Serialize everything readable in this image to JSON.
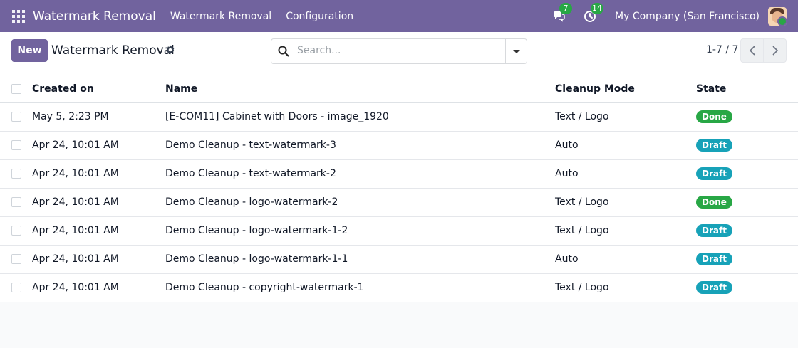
{
  "navbar": {
    "brand": "Watermark Removal",
    "menu": [
      "Watermark Removal",
      "Configuration"
    ],
    "messages_count": "7",
    "activities_count": "14",
    "company": "My Company (San Francisco)"
  },
  "control_panel": {
    "new_label": "New",
    "title": "Watermark Removal",
    "search_placeholder": "Search...",
    "pager": "1-7 / 7"
  },
  "table": {
    "headers": [
      "Created on",
      "Name",
      "Cleanup Mode",
      "State"
    ],
    "rows": [
      {
        "created": "May 5, 2:23 PM",
        "name": "[E-COM11] Cabinet with Doors - image_1920",
        "mode": "Text / Logo",
        "state": "Done"
      },
      {
        "created": "Apr 24, 10:01 AM",
        "name": "Demo Cleanup - text-watermark-3",
        "mode": "Auto",
        "state": "Draft"
      },
      {
        "created": "Apr 24, 10:01 AM",
        "name": "Demo Cleanup - text-watermark-2",
        "mode": "Auto",
        "state": "Draft"
      },
      {
        "created": "Apr 24, 10:01 AM",
        "name": "Demo Cleanup - logo-watermark-2",
        "mode": "Text / Logo",
        "state": "Done"
      },
      {
        "created": "Apr 24, 10:01 AM",
        "name": "Demo Cleanup - logo-watermark-1-2",
        "mode": "Text / Logo",
        "state": "Draft"
      },
      {
        "created": "Apr 24, 10:01 AM",
        "name": "Demo Cleanup - logo-watermark-1-1",
        "mode": "Auto",
        "state": "Draft"
      },
      {
        "created": "Apr 24, 10:01 AM",
        "name": "Demo Cleanup - copyright-watermark-1",
        "mode": "Text / Logo",
        "state": "Draft"
      }
    ]
  },
  "colors": {
    "brand": "#71639e",
    "done": "#28a745",
    "draft": "#17a2b8"
  }
}
